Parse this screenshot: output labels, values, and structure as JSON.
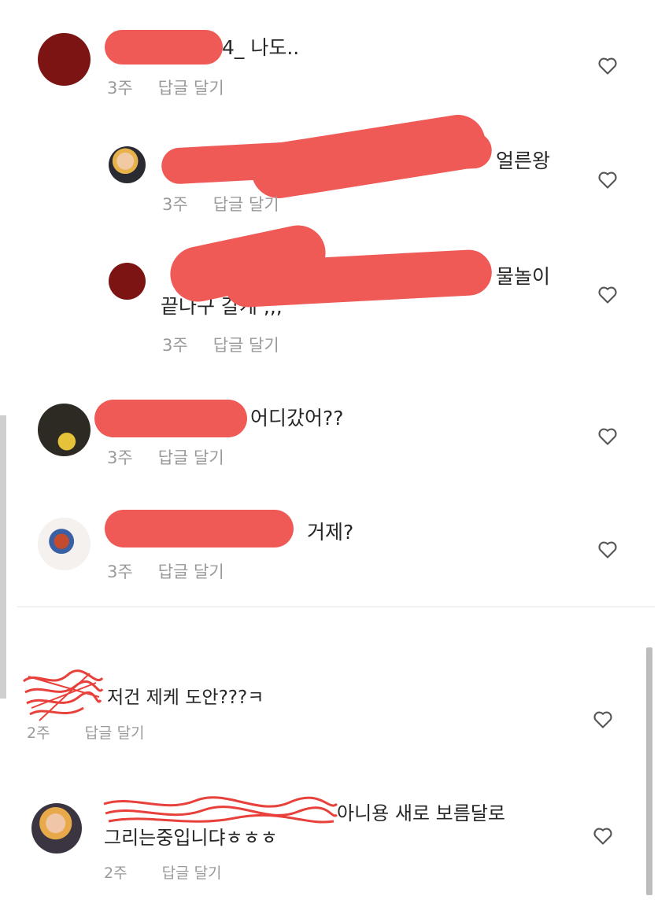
{
  "comments": [
    {
      "text": "4_ 나도..",
      "time": "3주",
      "reply": "답글 달기"
    },
    {
      "text": "얼른왕",
      "time": "3주",
      "reply": "답글 달기"
    },
    {
      "line1": "물놀이",
      "line2": "끝나구 갈게 ,,,",
      "time": "3주",
      "reply": "답글 달기"
    },
    {
      "text": "어디갔어??",
      "time": "3주",
      "reply": "답글 달기"
    },
    {
      "text": "거제?",
      "time": "3주",
      "reply": "답글 달기"
    },
    {
      "text": "저건 제케 도안???ㅋ",
      "time": "2주",
      "reply": "답글 달기"
    },
    {
      "line1": "아니용 새로 보름달로",
      "line2": "그리는중입니댜ㅎㅎㅎ",
      "time": "2주",
      "reply": "답글 달기"
    }
  ],
  "icons": {
    "like": "heart-outline-icon"
  },
  "colors": {
    "redaction": "#ef5a56",
    "meta_text": "#9a9a9a"
  }
}
